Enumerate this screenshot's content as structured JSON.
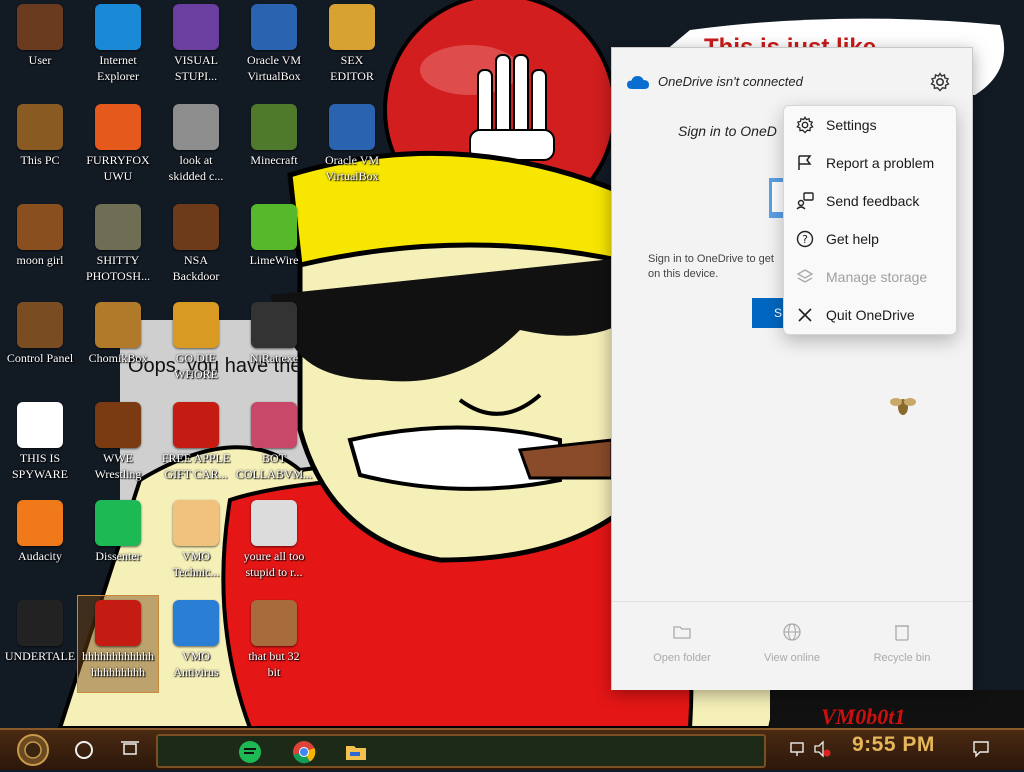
{
  "desktop": {
    "icons": [
      {
        "label": "User",
        "icon": "user-folder-icon",
        "color": "#6b3b1f"
      },
      {
        "label": "Internet\nExplorer",
        "icon": "edge-browser-icon",
        "color": "#1b8ad6"
      },
      {
        "label": "VISUAL\nSTUPI...",
        "icon": "visual-studio-icon",
        "color": "#6b3fa0"
      },
      {
        "label": "Oracle VM\nVirtualBox",
        "icon": "virtualbox-icon",
        "color": "#2a64b0"
      },
      {
        "label": "SEX\nEDITOR",
        "icon": "hex-editor-icon",
        "color": "#d8a233"
      },
      {
        "label": "This PC",
        "icon": "this-pc-icon",
        "color": "#8a5a23"
      },
      {
        "label": "FURRYFOX\nUWU",
        "icon": "firefox-icon",
        "color": "#e55a1c"
      },
      {
        "label": "look at\nskidded c...",
        "icon": "copy-icon",
        "color": "#8d8d8d"
      },
      {
        "label": "Minecraft",
        "icon": "minecraft-icon",
        "color": "#4f7a2c"
      },
      {
        "label": "Oracle VM\nVirtualBox",
        "icon": "virtualbox-icon",
        "color": "#2a64b0"
      },
      {
        "label": "moon girl",
        "icon": "folder-icon",
        "color": "#8a4f1f"
      },
      {
        "label": "SHITTY\nPHOTOSH...",
        "icon": "gimp-icon",
        "color": "#6e6e55"
      },
      {
        "label": "NSA\nBackdoor",
        "icon": "steampunk-icon",
        "color": "#6e3b1a"
      },
      {
        "label": "LimeWire",
        "icon": "limewire-icon",
        "color": "#56b82b"
      },
      {
        "label": "Control Panel",
        "icon": "control-panel-icon",
        "color": "#7a4c22"
      },
      {
        "label": "ChomikBox",
        "icon": "chomikbox-icon",
        "color": "#b07a2a"
      },
      {
        "label": "GO DIE\nWHORE",
        "icon": "dev-editor-icon",
        "color": "#d99a24"
      },
      {
        "label": "NjRat.exe",
        "icon": "skull-icon",
        "color": "#333333"
      },
      {
        "label": "THIS IS\nSPYWARE",
        "icon": "chrome-icon",
        "color": "#ffffff"
      },
      {
        "label": "WWE\nWrestling",
        "icon": "wrestling-icon",
        "color": "#7a3b12"
      },
      {
        "label": "FREE APPLE\nGIFT CAR...",
        "icon": "apple-icon",
        "color": "#c41b12"
      },
      {
        "label": "BOT\nCOLLABVM...",
        "icon": "monitor-icon",
        "color": "#c8486a"
      },
      {
        "label": "Audacity",
        "icon": "audacity-icon",
        "color": "#f07a1a"
      },
      {
        "label": "Dissenter",
        "icon": "dissenter-icon",
        "color": "#1db954"
      },
      {
        "label": "VMO\nTechnic...",
        "icon": "technician-icon",
        "color": "#f1c27d"
      },
      {
        "label": "youre all too\nstupid to r...",
        "icon": "portrait-icon",
        "color": "#dcdcdc"
      },
      {
        "label": "UNDERTALE",
        "icon": "unity-icon",
        "color": "#222222"
      },
      {
        "label": "hhhhhhhhhhhh\nhhhhhhhhh",
        "icon": "dev-cpp-icon",
        "color": "#c41b12"
      },
      {
        "label": "VMO\nAntivirus",
        "icon": "shield-icon",
        "color": "#2a7fd4"
      },
      {
        "label": "that but 32\nbit",
        "icon": "portrait-icon",
        "color": "#a86b3c"
      }
    ]
  },
  "wallpaper": {
    "top_text": "This is just like",
    "mid_text": "Oops, you have the",
    "corner_text": "VM0b0t1"
  },
  "onedrive": {
    "status_title": "OneDrive isn't connected",
    "signin_heading": "Sign in to OneD",
    "body_text": "Sign in to OneDrive to get\non this device.",
    "signin_button": "S",
    "footer": [
      {
        "label": "Open folder",
        "icon": "folder-icon"
      },
      {
        "label": "View online",
        "icon": "globe-icon"
      },
      {
        "label": "Recycle bin",
        "icon": "recycle-bin-icon"
      }
    ],
    "accent": "#0067c0"
  },
  "context_menu": {
    "items": [
      {
        "label": "Settings",
        "icon": "gear-icon",
        "enabled": true
      },
      {
        "label": "Report a problem",
        "icon": "flag-icon",
        "enabled": true
      },
      {
        "label": "Send feedback",
        "icon": "feedback-icon",
        "enabled": true
      },
      {
        "label": "Get help",
        "icon": "help-icon",
        "enabled": true
      },
      {
        "label": "Manage storage",
        "icon": "layers-icon",
        "enabled": false
      },
      {
        "label": "Quit OneDrive",
        "icon": "close-icon",
        "enabled": true
      }
    ]
  },
  "taskbar": {
    "clock": "9:55 PM",
    "apps": [
      "dissenter-icon",
      "chrome-icon",
      "file-explorer-icon"
    ],
    "tray": [
      "network-icon",
      "volume-muted-icon",
      "notifications-icon"
    ],
    "clock_color": "#e6b658"
  }
}
